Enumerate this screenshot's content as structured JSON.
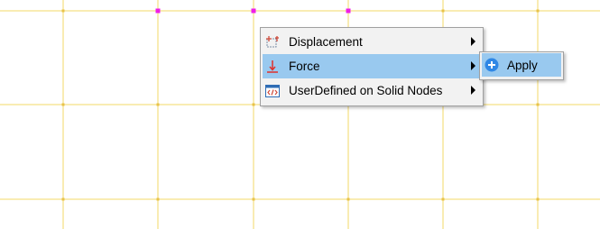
{
  "context_menu": {
    "items": [
      {
        "label": "Displacement",
        "icon": "displacement-icon",
        "has_submenu": true
      },
      {
        "label": "Force",
        "icon": "force-icon",
        "has_submenu": true,
        "highlighted": true
      },
      {
        "label": "UserDefined on Solid Nodes",
        "icon": "xml-code-icon",
        "has_submenu": true
      }
    ]
  },
  "submenu": {
    "items": [
      {
        "label": "Apply",
        "icon": "plus-circle-icon",
        "highlighted": true
      }
    ]
  },
  "colors": {
    "grid_line": "#f3d867",
    "grid_node": "#e8c24a",
    "selected_node": "#ee1ee8",
    "menu_highlight": "#99c9ef",
    "apply_icon": "#2f87e5"
  }
}
